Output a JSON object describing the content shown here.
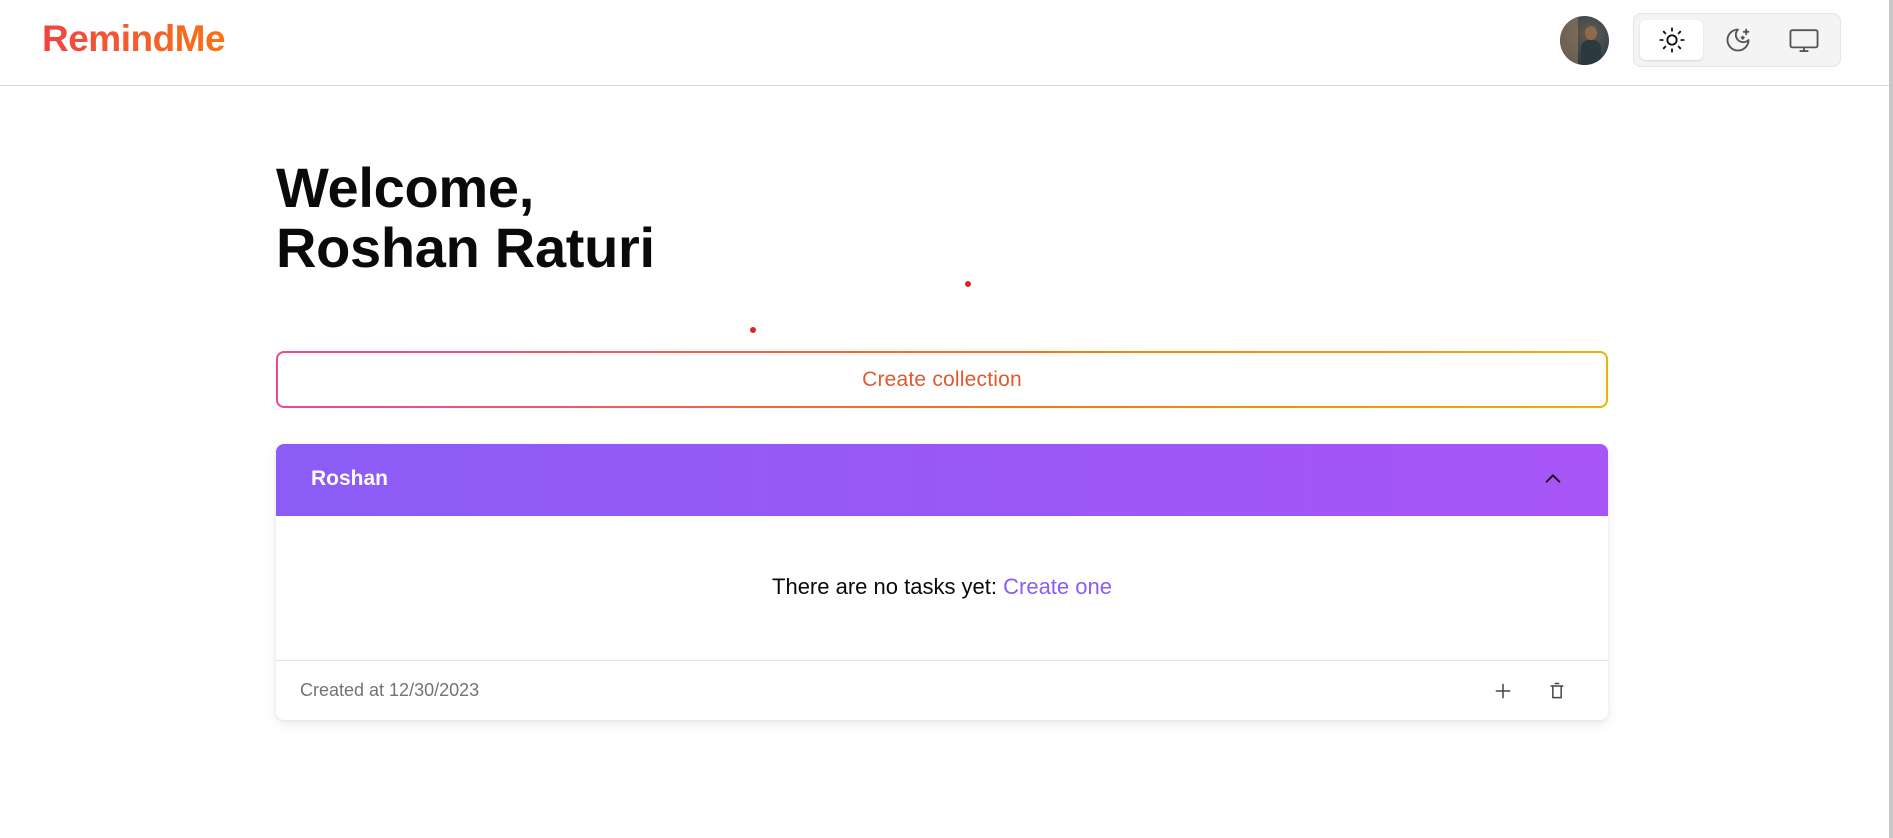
{
  "app": {
    "logo": "RemindMe"
  },
  "header": {
    "avatar_icon": "user-avatar",
    "theme_options": [
      {
        "name": "light",
        "icon": "sun-icon",
        "active": true
      },
      {
        "name": "dark",
        "icon": "moon-stars-icon",
        "active": false
      },
      {
        "name": "system",
        "icon": "monitor-icon",
        "active": false
      }
    ]
  },
  "main": {
    "welcome_line1": "Welcome,",
    "welcome_line2": "Roshan Raturi",
    "create_collection_label": "Create collection"
  },
  "collection": {
    "title": "Roshan",
    "header_color_from": "#8b5cf6",
    "header_color_to": "#a855f7",
    "empty_text": "There are no tasks yet: ",
    "create_link": "Create one",
    "created_at": "Created at 12/30/2023",
    "icons": [
      "chevron-up-icon",
      "plus-icon",
      "trash-icon"
    ]
  },
  "colors": {
    "logo_gradient": [
      "#ef4444",
      "#f97316"
    ],
    "create_border_gradient": [
      "#ec4899",
      "#f97316",
      "#eab308"
    ],
    "link": "#8b5cf6"
  }
}
